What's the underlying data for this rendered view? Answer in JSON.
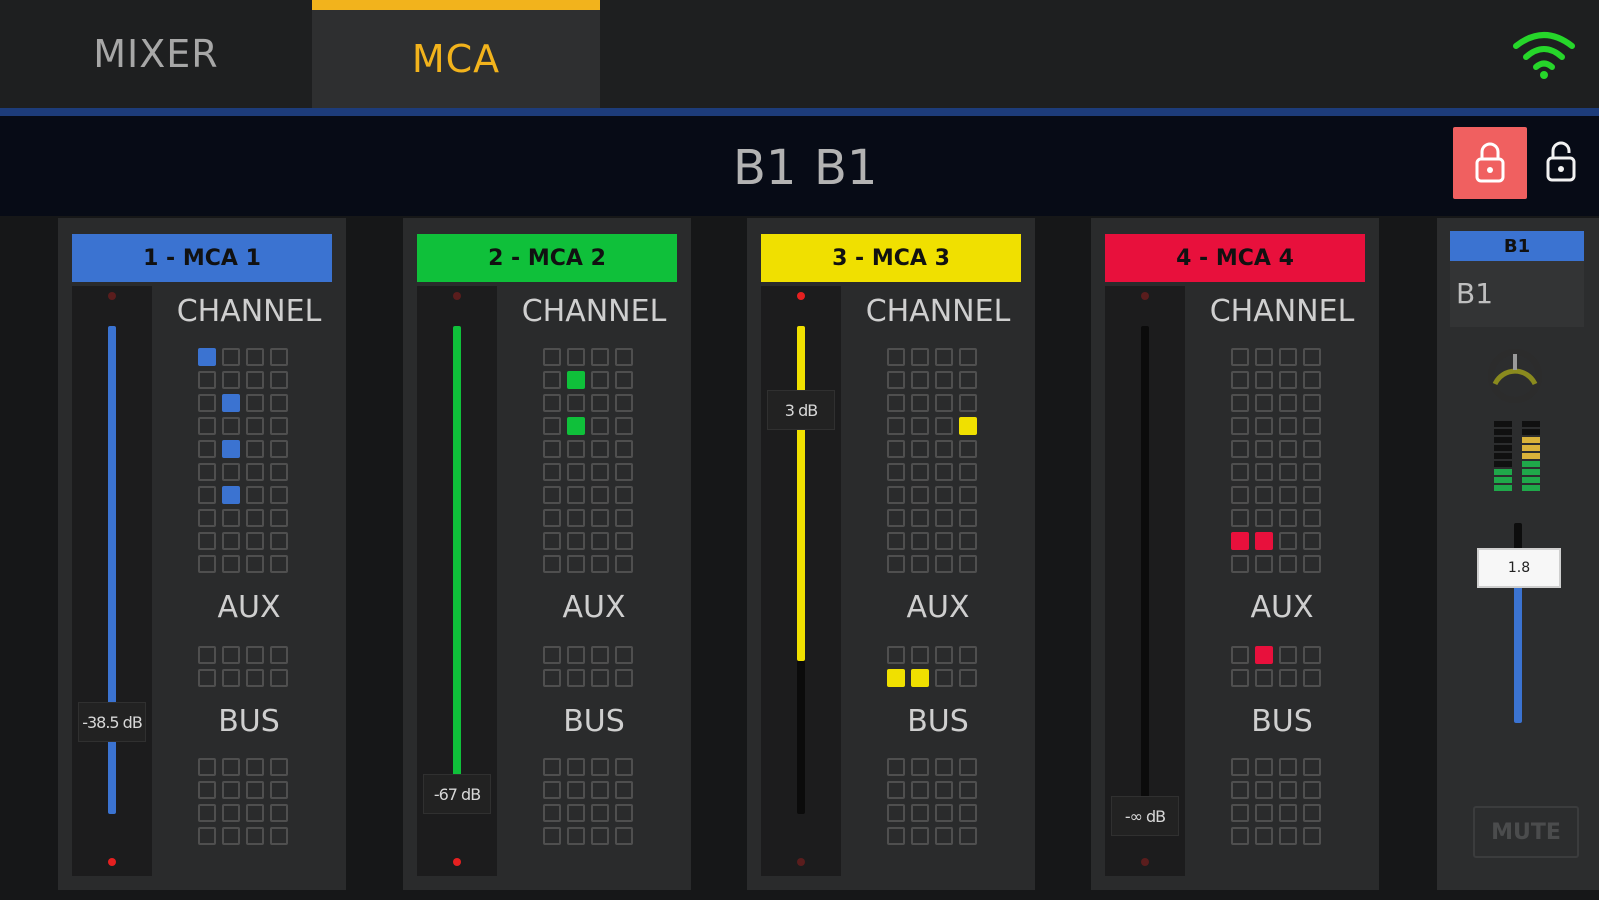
{
  "tabs": [
    {
      "label": "MIXER",
      "active": false
    },
    {
      "label": "MCA",
      "active": true
    }
  ],
  "header": {
    "name_left": "B1",
    "name_right": "B1",
    "lock_color": "#f06060"
  },
  "section_titles": {
    "channel": "CHANNEL",
    "aux": "AUX",
    "bus": "BUS"
  },
  "strips": [
    {
      "label": "1 - MCA 1",
      "color": "#3b73d1",
      "fader_value": "-38.5 dB",
      "fader_level": 0.15,
      "peak_top": false,
      "peak_bottom": true,
      "channel_on": [
        0,
        9,
        17,
        25
      ],
      "aux_on": [],
      "bus_on": []
    },
    {
      "label": "2 - MCA 2",
      "color": "#0fc03a",
      "fader_value": "-67 dB",
      "fader_level": 0.0,
      "peak_top": false,
      "peak_bottom": true,
      "channel_on": [
        5,
        13
      ],
      "aux_on": [],
      "bus_on": []
    },
    {
      "label": "3 - MCA 3",
      "color": "#f0e000",
      "fader_value": "3 dB",
      "fader_level": 1.0,
      "peak_top": true,
      "peak_bottom": false,
      "channel_on": [
        15
      ],
      "aux_on": [
        4,
        5
      ],
      "bus_on": []
    },
    {
      "label": "4 - MCA 4",
      "color": "#e8103c",
      "fader_value": "-∞ dB",
      "fader_level": 0.0,
      "peak_top": false,
      "peak_bottom": false,
      "channel_on": [
        32,
        33
      ],
      "aux_on": [
        1
      ],
      "bus_on": []
    }
  ],
  "b1_strip": {
    "label": "B1",
    "name": "B1",
    "fader_value": "1.8",
    "mute_label": "MUTE",
    "knob_color": "#8a8a1e",
    "accent": "#3b73d1"
  },
  "icons": {
    "wifi": "wifi-icon",
    "lock": "lock-icon",
    "unlock": "unlock-icon",
    "knob": "pan-knob-icon"
  }
}
